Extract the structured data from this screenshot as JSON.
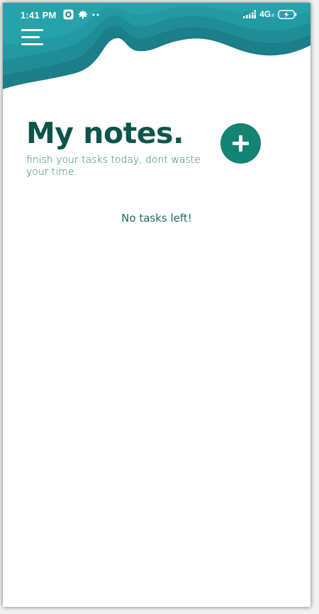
{
  "status_bar": {
    "time": "1:41 PM",
    "network": "4G",
    "network_sub": "#",
    "left_icons": [
      "record-icon",
      "leaf-icon",
      "more-dots-icon"
    ],
    "right_icons": [
      "signal-icon",
      "battery-charging-icon"
    ]
  },
  "header": {
    "menu_icon": "hamburger-menu-icon",
    "wave_colors": [
      "#1b7e88",
      "#208f98",
      "#25a0a8"
    ]
  },
  "main": {
    "title": "My notes.",
    "subtitle": "finish your tasks today, dont waste your time.",
    "empty_message": "No tasks left!"
  },
  "add_button": {
    "icon": "plus-icon",
    "color": "#138474"
  },
  "colors": {
    "title": "#0d5548",
    "subtitle": "#237a6d",
    "accent": "#138474",
    "header": "#1b7e88"
  }
}
